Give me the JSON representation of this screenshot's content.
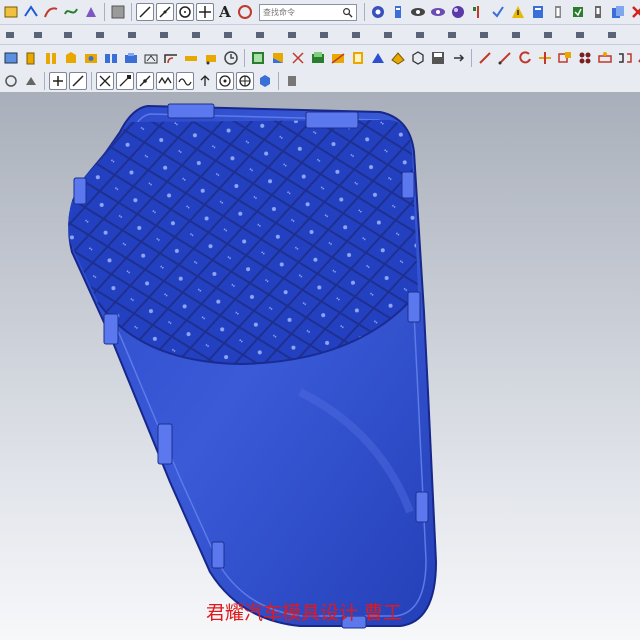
{
  "app": {
    "search": {
      "placeholder": "查找命令",
      "icon": "search-icon"
    }
  },
  "toolbar": {
    "row1": [
      "layer-icon",
      "sketch-icon",
      "curve-icon",
      "spline-icon",
      "snap-icon",
      "color-box-icon",
      "line-icon",
      "arc-icon",
      "circle-icon",
      "point-icon",
      "text-icon",
      "circle-target-icon",
      "view-icon",
      "measure-icon",
      "analysis-icon",
      "display-icon",
      "render-icon",
      "tool-icon",
      "check-icon",
      "warning-icon",
      "grid-icon",
      "mirror-icon",
      "edit-icon",
      "settings-icon",
      "copy-icon",
      "delete-icon",
      "chart-icon",
      "help-icon"
    ],
    "row2": [
      "window-icon",
      "extrude-icon",
      "revolve-icon",
      "shell-icon",
      "hole-icon",
      "pattern-icon",
      "rib-icon",
      "draft-icon",
      "fillet-icon",
      "measure-distance-icon",
      "sheet-icon",
      "chamfer-icon",
      "image-icon",
      "palette-icon",
      "edge-icon",
      "boolean-icon",
      "trim-icon",
      "offset-icon",
      "thicken-icon",
      "body-icon",
      "sew-icon",
      "save-icon",
      "section-icon",
      "curve-edit-icon",
      "line-tool-icon",
      "rotate-icon",
      "split-icon",
      "blend-icon",
      "surface-icon",
      "face-icon",
      "layer-settings-icon",
      "bridge-icon",
      "trim-curve-icon",
      "arrow-icon",
      "arc-tool-icon",
      "vertex-icon",
      "menu-icon",
      "text-tool-icon",
      "table-icon",
      "gear-icon"
    ],
    "row3": [
      "cube-icon",
      "plus-icon",
      "slash-icon",
      "vertex-snap-icon",
      "end-snap-icon",
      "mid-snap-icon",
      "wave-icon",
      "arrow-up-icon",
      "circle-dot-icon",
      "target-icon",
      "shape-icon",
      "filter-icon"
    ]
  },
  "viewport": {
    "model_color": "#2f4fd1",
    "background_top": "#a9afba",
    "background_bottom": "#f7f8fa"
  },
  "watermark": {
    "text": "君耀汽车模具设计 曹工",
    "color": "#e0191c"
  }
}
